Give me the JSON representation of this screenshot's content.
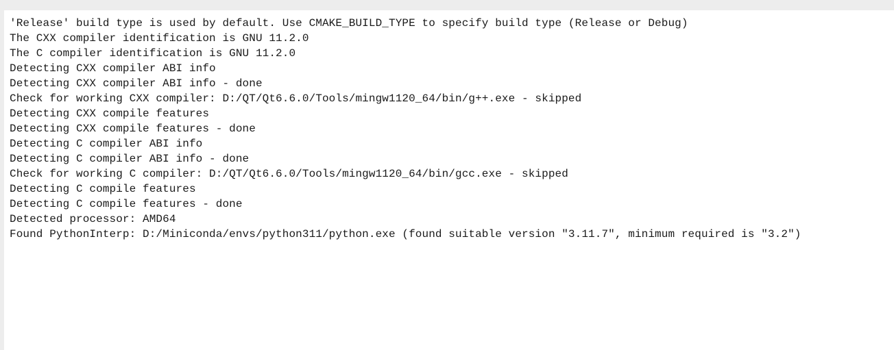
{
  "console": {
    "lines": [
      "'Release' build type is used by default. Use CMAKE_BUILD_TYPE to specify build type (Release or Debug)",
      "The CXX compiler identification is GNU 11.2.0",
      "The C compiler identification is GNU 11.2.0",
      "Detecting CXX compiler ABI info",
      "Detecting CXX compiler ABI info - done",
      "Check for working CXX compiler: D:/QT/Qt6.6.0/Tools/mingw1120_64/bin/g++.exe - skipped",
      "Detecting CXX compile features",
      "Detecting CXX compile features - done",
      "Detecting C compiler ABI info",
      "Detecting C compiler ABI info - done",
      "Check for working C compiler: D:/QT/Qt6.6.0/Tools/mingw1120_64/bin/gcc.exe - skipped",
      "Detecting C compile features",
      "Detecting C compile features - done",
      "Detected processor: AMD64",
      "Found PythonInterp: D:/Miniconda/envs/python311/python.exe (found suitable version \"3.11.7\", minimum required is \"3.2\")"
    ]
  }
}
